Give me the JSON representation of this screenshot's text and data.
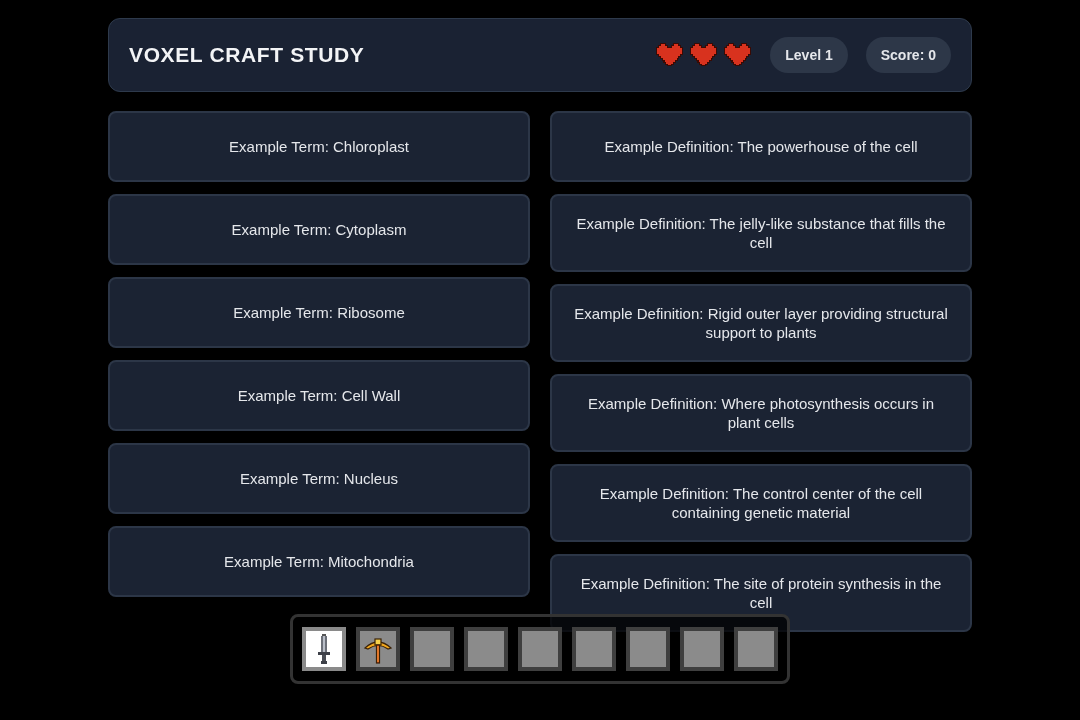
{
  "header": {
    "title": "VOXEL CRAFT STUDY",
    "hearts": [
      {
        "filled": true
      },
      {
        "filled": true
      },
      {
        "filled": true
      }
    ],
    "level": "Level 1",
    "score": "Score: 0"
  },
  "terms": [
    "Example Term: Chloroplast",
    "Example Term: Cytoplasm",
    "Example Term: Ribosome",
    "Example Term: Cell Wall",
    "Example Term: Nucleus",
    "Example Term: Mitochondria"
  ],
  "definitions": [
    "Example Definition: The powerhouse of the cell",
    "Example Definition: The jelly-like substance that fills the cell",
    "Example Definition: Rigid outer layer providing structural support to plants",
    "Example Definition: Where photosynthesis occurs in plant cells",
    "Example Definition: The control center of the cell containing genetic material",
    "Example Definition: The site of protein synthesis in the cell"
  ],
  "hotbar": {
    "slots": [
      {
        "kind": "sword",
        "selected": true
      },
      {
        "kind": "pickaxe",
        "selected": false
      },
      {
        "kind": "empty",
        "selected": false
      },
      {
        "kind": "empty",
        "selected": false
      },
      {
        "kind": "empty",
        "selected": false
      },
      {
        "kind": "empty",
        "selected": false
      },
      {
        "kind": "empty",
        "selected": false
      },
      {
        "kind": "empty",
        "selected": false
      },
      {
        "kind": "empty",
        "selected": false
      }
    ]
  }
}
